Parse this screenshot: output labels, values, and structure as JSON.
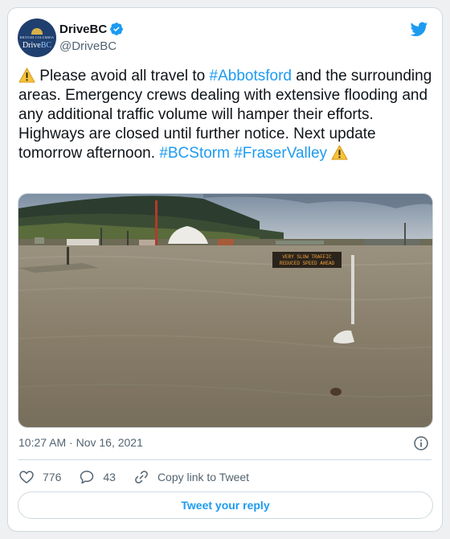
{
  "author": {
    "display_name": "DriveBC",
    "handle": "@DriveBC",
    "verified": true,
    "avatar_text": {
      "top": "BRITISH COLUMBIA",
      "brand_main": "Drive",
      "brand_accent": "BC"
    }
  },
  "tweet": {
    "segments": [
      {
        "type": "emoji",
        "name": "warning-icon"
      },
      {
        "type": "text",
        "text": " Please avoid all travel to "
      },
      {
        "type": "hashtag",
        "text": "#Abbotsford"
      },
      {
        "type": "text",
        "text": " and the surrounding areas. Emergency crews dealing with extensive flooding and any additional traffic volume will hamper their efforts. Highways are closed until further notice. Next update tomorrow afternoon. "
      },
      {
        "type": "hashtag",
        "text": "#BCStorm"
      },
      {
        "type": "text",
        "text": " "
      },
      {
        "type": "hashtag",
        "text": "#FraserValley"
      },
      {
        "type": "text",
        "text": " "
      },
      {
        "type": "emoji",
        "name": "warning-icon"
      }
    ],
    "image": {
      "sign_line1": "VERY SLOW TRAFFIC",
      "sign_line2": "REDUCED SPEED AHEAD"
    },
    "timestamp": "10:27 AM · Nov 16, 2021"
  },
  "actions": {
    "likes": "776",
    "replies": "43",
    "copy_link": "Copy link to Tweet",
    "reply_button": "Tweet your reply"
  },
  "icons": {
    "brand": "twitter-bird-icon",
    "verified": "verified-badge-icon",
    "info": "info-icon",
    "like": "heart-icon",
    "reply": "reply-bubble-icon",
    "link": "link-icon"
  },
  "colors": {
    "accent": "#1d9bf0",
    "text": "#0f1419",
    "muted": "#536471",
    "border": "#cfd9de",
    "warning": "#f5c33b"
  }
}
